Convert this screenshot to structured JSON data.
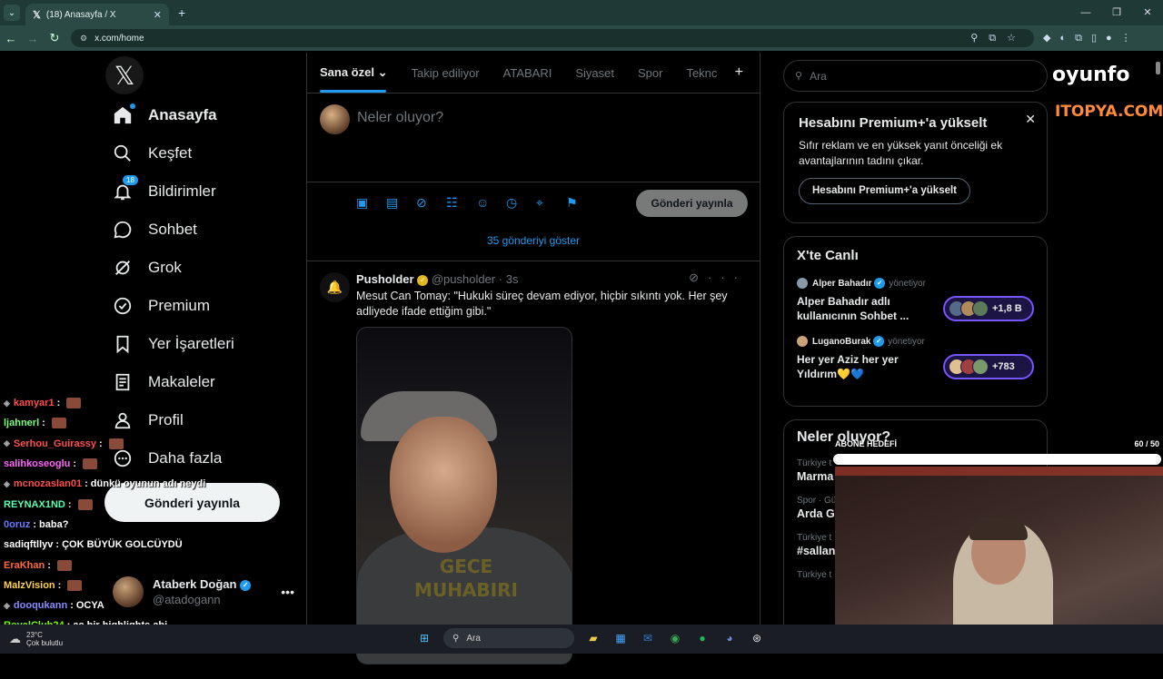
{
  "browser": {
    "tab_title": "(18) Anasayfa / X",
    "url": "x.com/home"
  },
  "nav": {
    "items": [
      {
        "label": "Anasayfa",
        "icon": "home-icon"
      },
      {
        "label": "Keşfet",
        "icon": "search-icon"
      },
      {
        "label": "Bildirimler",
        "icon": "bell-icon",
        "badge": "18"
      },
      {
        "label": "Sohbet",
        "icon": "chat-icon"
      },
      {
        "label": "Grok",
        "icon": "grok-icon"
      },
      {
        "label": "Premium",
        "icon": "premium-icon"
      },
      {
        "label": "Yer İşaretleri",
        "icon": "bookmark-icon"
      },
      {
        "label": "Makaleler",
        "icon": "article-icon"
      },
      {
        "label": "Profil",
        "icon": "profile-icon"
      },
      {
        "label": "Daha fazla",
        "icon": "more-icon"
      }
    ],
    "post_button": "Gönderi yayınla"
  },
  "account": {
    "display_name": "Ataberk Doğan",
    "handle": "@atadogann"
  },
  "feed": {
    "tabs": [
      "Sana özel",
      "Takip ediliyor",
      "ATABARI",
      "Siyaset",
      "Spor",
      "Teknc"
    ],
    "compose_placeholder": "Neler oluyor?",
    "compose_button": "Gönderi yayınla",
    "show_more": "35 gönderiyi göster",
    "tweet": {
      "name": "Pusholder",
      "handle": "@pusholder",
      "time": "3s",
      "text": "Mesut Can Tomay: \"Hukuki süreç devam ediyor, hiçbir sıkıntı yok. Her şey adliyede ifade ettiğim gibi.\"",
      "media_text_line1": "GECE",
      "media_text_line2": "MUHABIRI"
    }
  },
  "right": {
    "search_placeholder": "Ara",
    "premium": {
      "title": "Hesabını Premium+'a yükselt",
      "description": "Sıfır reklam ve en yüksek yanıt önceliği ek avantajlarının tadını çıkar.",
      "button": "Hesabını Premium+'a yükselt"
    },
    "live": {
      "title": "X'te Canlı",
      "entries": [
        {
          "host": "Alper Bahadır",
          "role": "yönetiyor",
          "desc": "Alper Bahadır adlı kullanıcının Sohbet ...",
          "count": "+1,8 B"
        },
        {
          "host": "LuganoBurak",
          "role": "yönetiyor",
          "desc": "Her yer Aziz her yer Yıldırım💛💙",
          "count": "+783"
        }
      ]
    },
    "trends": {
      "title": "Neler oluyor?",
      "items": [
        {
          "category": "Türkiye t",
          "name": "Marma"
        },
        {
          "category": "Spor · Gü",
          "name": "Arda Gü"
        },
        {
          "category": "Türkiye t",
          "name": "#sallan"
        },
        {
          "category": "Türkiye t",
          "name": ""
        }
      ]
    }
  },
  "overlay": {
    "brand_top": "oyunfo",
    "brand_bottom": "ITOPYA.COM",
    "goal_label": "ABONE HEDEFİ",
    "goal_count": "60 / 50",
    "goal_fraction": 1.0
  },
  "chat": [
    {
      "user": "kamyar1",
      "color": "#ff4d4d",
      "msg": "",
      "emote": true,
      "icon": true
    },
    {
      "user": "ljahnerl",
      "color": "#7cfc7c",
      "msg": "",
      "emote": true,
      "icon": false
    },
    {
      "user": "Serhou_Guirassy",
      "color": "#ff4d4d",
      "msg": "",
      "emote": true,
      "icon": true
    },
    {
      "user": "salihkoseoglu",
      "color": "#ff66ff",
      "msg": "",
      "emote": true,
      "icon": false
    },
    {
      "user": "mcnozaslan01",
      "color": "#ff4d4d",
      "msg": "dünkü oyunun adı neydi",
      "emote": false,
      "icon": true
    },
    {
      "user": "REYNAX1ND",
      "color": "#5cffb0",
      "msg": "",
      "emote": true,
      "icon": false
    },
    {
      "user": "0oruz",
      "color": "#6a7bff",
      "msg": "baba?",
      "emote": false,
      "icon": false
    },
    {
      "user": "sadiqftllyv",
      "color": "#ffffff",
      "msg": "ÇOK BÜYÜK GOLCÜYDÜ",
      "emote": false,
      "icon": false
    },
    {
      "user": "EraKhan",
      "color": "#ff6a3d",
      "msg": "",
      "emote": true,
      "icon": false
    },
    {
      "user": "MalzVision",
      "color": "#ffd24d",
      "msg": "",
      "emote": true,
      "icon": false
    },
    {
      "user": "dooqukann",
      "color": "#8a8aff",
      "msg": "OCYA",
      "emote": false,
      "icon": true
    },
    {
      "user": "RoyalClub24",
      "color": "#7cfc00",
      "msg": "ac bir highlights abi",
      "emote": false,
      "icon": false
    }
  ],
  "taskbar": {
    "temp": "23°C",
    "weather": "Çok bulutlu",
    "search": "Ara"
  }
}
